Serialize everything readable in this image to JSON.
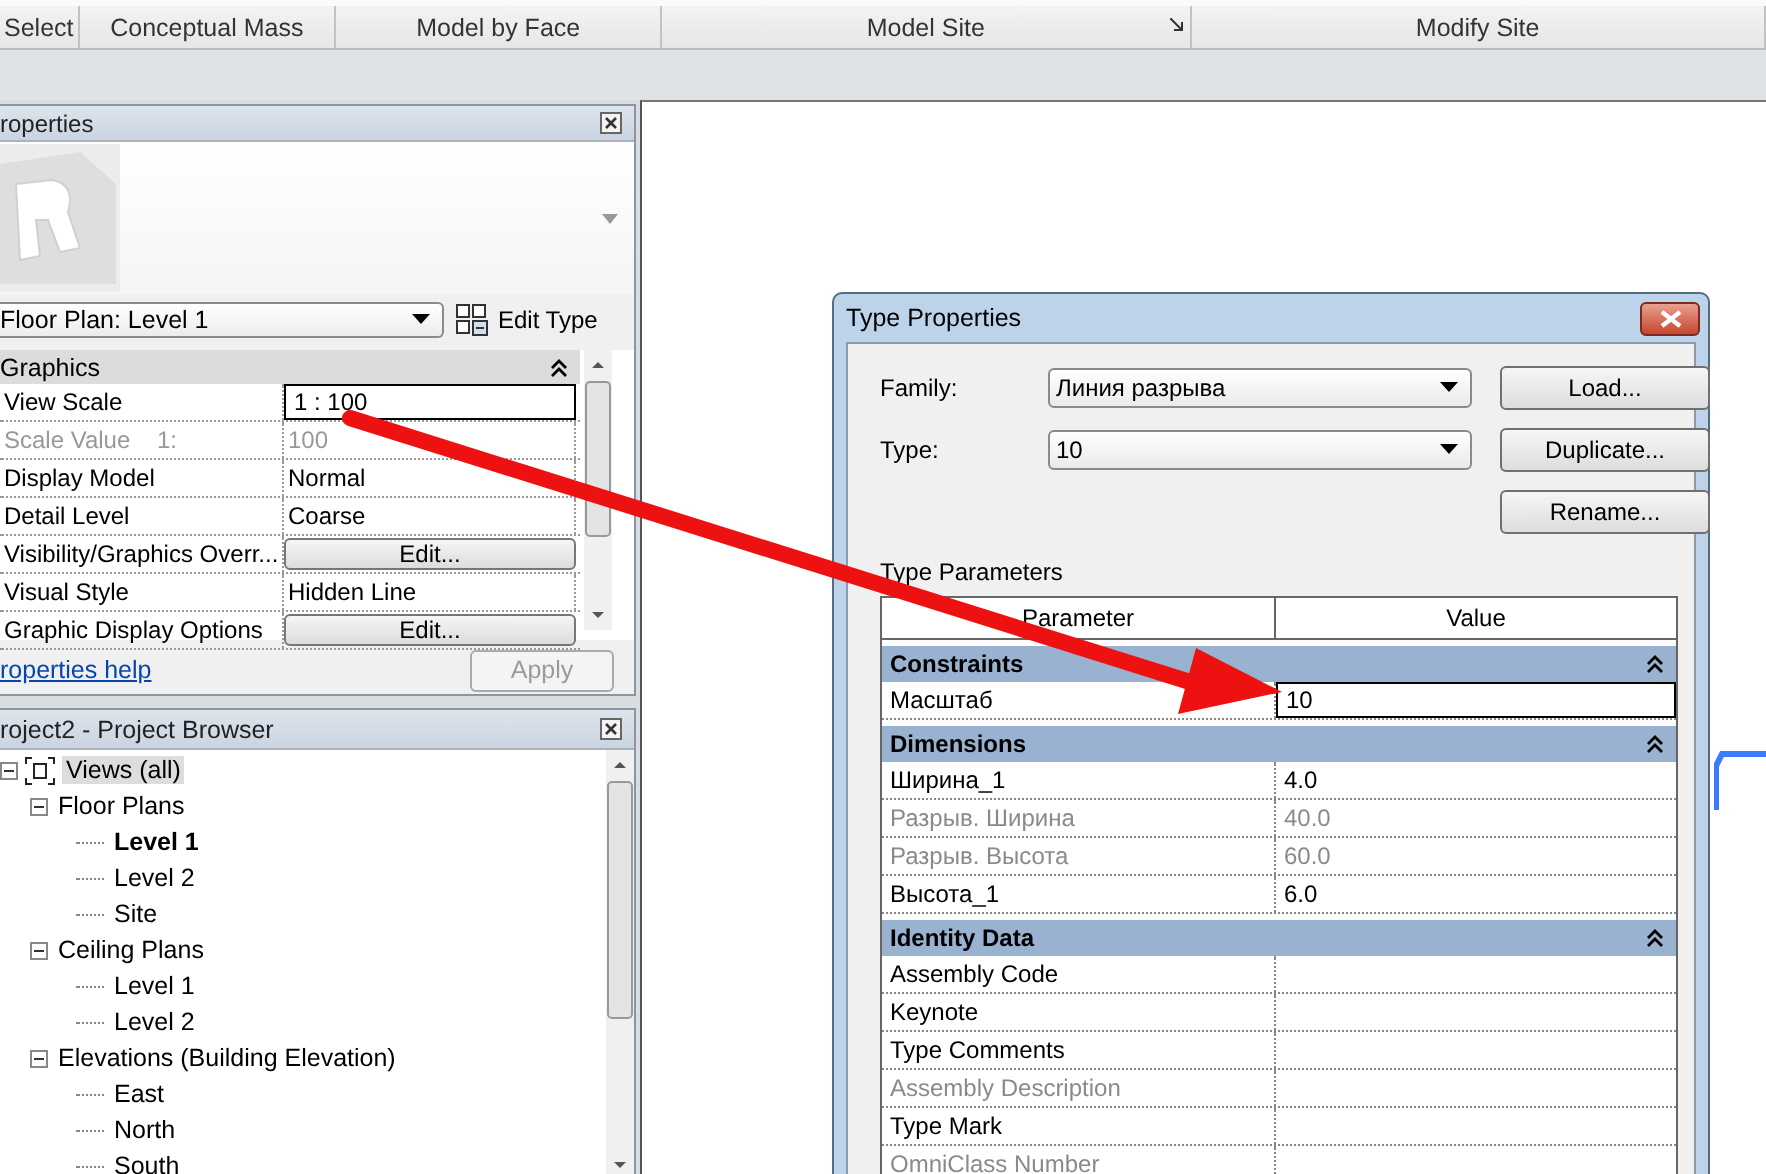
{
  "ribbon": {
    "panels": [
      {
        "label": "Select",
        "launcher": false
      },
      {
        "label": "Conceptual Mass",
        "launcher": false
      },
      {
        "label": "Model by Face",
        "launcher": false
      },
      {
        "label": "Model Site",
        "launcher": true
      },
      {
        "label": "Modify Site",
        "launcher": false
      }
    ]
  },
  "properties": {
    "title": "roperties",
    "type_selector": "Floor Plan: Level 1",
    "edit_type": "Edit Type",
    "group": {
      "label": "Graphics",
      "expanded": true
    },
    "rows": [
      {
        "name": "View Scale",
        "value": "1 : 100",
        "kind": "field",
        "disabled": false
      },
      {
        "name": "Scale Value    1:",
        "value": "100",
        "kind": "text",
        "disabled": true
      },
      {
        "name": "Display Model",
        "value": "Normal",
        "kind": "text",
        "disabled": false
      },
      {
        "name": "Detail Level",
        "value": "Coarse",
        "kind": "text",
        "disabled": false
      },
      {
        "name": "Visibility/Graphics Overr...",
        "value": "Edit...",
        "kind": "button",
        "disabled": false
      },
      {
        "name": "Visual Style",
        "value": "Hidden Line",
        "kind": "text",
        "disabled": false
      },
      {
        "name": "Graphic Display Options",
        "value": "Edit...",
        "kind": "button",
        "disabled": false
      }
    ],
    "help_link": "roperties help",
    "apply": {
      "label": "Apply",
      "disabled": true
    }
  },
  "project_browser": {
    "title": "roject2 - Project Browser",
    "tree": [
      {
        "label": "Views (all)",
        "expanded": true,
        "selected": true,
        "active": false,
        "children": [
          {
            "label": "Floor Plans",
            "expanded": true,
            "selected": false,
            "active": false,
            "children": [
              {
                "label": "Level 1",
                "selected": false,
                "active": true
              },
              {
                "label": "Level 2",
                "selected": false,
                "active": false
              },
              {
                "label": "Site",
                "selected": false,
                "active": false
              }
            ]
          },
          {
            "label": "Ceiling Plans",
            "expanded": true,
            "selected": false,
            "active": false,
            "children": [
              {
                "label": "Level 1",
                "selected": false,
                "active": false
              },
              {
                "label": "Level 2",
                "selected": false,
                "active": false
              }
            ]
          },
          {
            "label": "Elevations (Building Elevation)",
            "expanded": true,
            "selected": false,
            "active": false,
            "children": [
              {
                "label": "East",
                "selected": false,
                "active": false
              },
              {
                "label": "North",
                "selected": false,
                "active": false
              },
              {
                "label": "South",
                "selected": false,
                "active": false
              }
            ]
          }
        ]
      }
    ]
  },
  "dialog": {
    "title": "Type Properties",
    "family": {
      "label": "Family:",
      "value": "Линия разрыва"
    },
    "type": {
      "label": "Type:",
      "value": "10"
    },
    "buttons": [
      "Load...",
      "Duplicate...",
      "Rename..."
    ],
    "section_label": "Type Parameters",
    "columns": [
      "Parameter",
      "Value"
    ],
    "groups": [
      {
        "label": "Constraints",
        "expanded": true,
        "rows": [
          {
            "name": "Масштаб",
            "value": "10",
            "editing": true,
            "disabled": false
          }
        ]
      },
      {
        "label": "Dimensions",
        "expanded": true,
        "rows": [
          {
            "name": "Ширина_1",
            "value": "4.0",
            "editing": false,
            "disabled": false
          },
          {
            "name": "Разрыв. Ширина",
            "value": "40.0",
            "editing": false,
            "disabled": true
          },
          {
            "name": "Разрыв. Высота",
            "value": "60.0",
            "editing": false,
            "disabled": true
          },
          {
            "name": "Высота_1",
            "value": "6.0",
            "editing": false,
            "disabled": false
          }
        ]
      },
      {
        "label": "Identity Data",
        "expanded": true,
        "rows": [
          {
            "name": "Assembly Code",
            "editing": false,
            "disabled": false
          },
          {
            "name": "Keynote",
            "editing": false,
            "disabled": false
          },
          {
            "name": "Type Comments",
            "editing": false,
            "disabled": false
          },
          {
            "name": "Assembly Description",
            "editing": false,
            "disabled": true
          },
          {
            "name": "Type Mark",
            "editing": false,
            "disabled": false
          },
          {
            "name": "OmniClass Number",
            "editing": false,
            "disabled": true
          }
        ]
      }
    ]
  }
}
